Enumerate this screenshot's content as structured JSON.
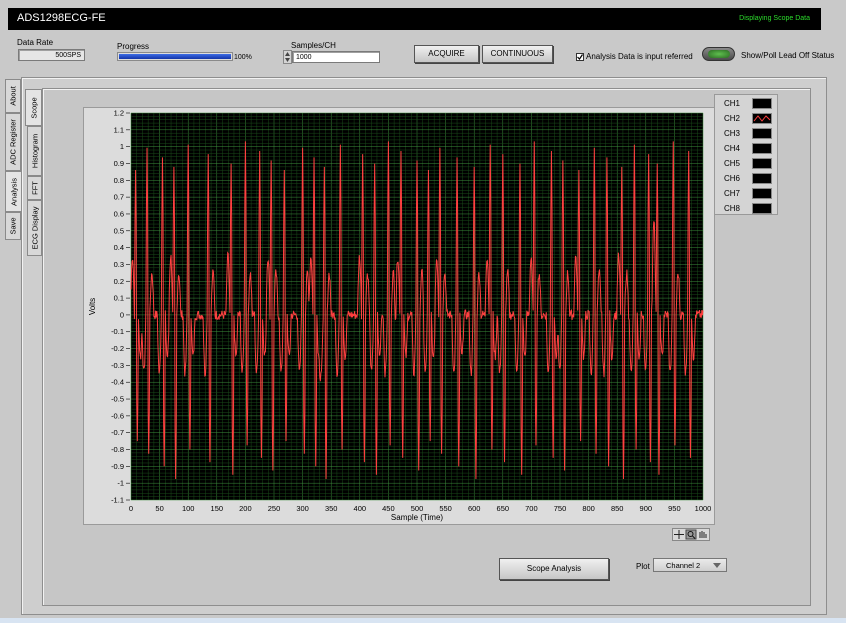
{
  "window": {
    "title": "ADS1298ECG-FE",
    "status": "Displaying Scope Data"
  },
  "controls": {
    "data_rate_label": "Data Rate",
    "data_rate_value": "500SPS",
    "progress_label": "Progress",
    "progress_value": "100%",
    "progress_fraction": 1.0,
    "samples_label": "Samples/CH",
    "samples_value": "1000",
    "acquire_label": "ACQUIRE",
    "continuous_label": "CONTINUOUS",
    "analysis_checkbox_label": "Analysis Data is input referred",
    "analysis_checked": true,
    "lead_off_label": "Show/Poll Lead Off Status"
  },
  "outer_tabs": [
    "About",
    "ADC Register",
    "Analysis",
    "Save"
  ],
  "inner_tabs": [
    "Scope",
    "Histogram",
    "FFT",
    "ECG Display"
  ],
  "legend": {
    "channels": [
      "CH1",
      "CH2",
      "CH3",
      "CH4",
      "CH5",
      "CH6",
      "CH7",
      "CH8"
    ],
    "active_channel": "CH2",
    "active_color": "#ff4040"
  },
  "bottom": {
    "scope_analysis_label": "Scope Analysis",
    "plot_label": "Plot",
    "plot_value": "Channel 2"
  },
  "chart_data": {
    "type": "line",
    "xlabel": "Sample (Time)",
    "ylabel": "Volts",
    "xlim": [
      0,
      1000
    ],
    "ylim": [
      -1.1,
      1.2
    ],
    "xticks": [
      "0",
      "50",
      "100",
      "150",
      "200",
      "250",
      "300",
      "350",
      "400",
      "450",
      "500",
      "550",
      "600",
      "650",
      "700",
      "750",
      "800",
      "850",
      "900",
      "950",
      "1000"
    ],
    "yticks": [
      "1.2",
      "1.1",
      "1",
      "0.9",
      "0.8",
      "0.7",
      "0.6",
      "0.5",
      "0.4",
      "0.3",
      "0.2",
      "0.1",
      "0",
      "-0.1",
      "-0.2",
      "-0.3",
      "-0.4",
      "-0.5",
      "-0.6",
      "-0.7",
      "-0.8",
      "-0.9",
      "-1",
      "-1.1"
    ],
    "grid": true,
    "background": "#000000",
    "grid_color": "#2f7a2f",
    "series": [
      {
        "name": "CH2",
        "color": "#ff4040",
        "approx_peak_sample_positions": [
          8,
          28,
          55,
          75,
          100,
          135,
          175,
          200,
          225,
          245,
          268,
          300,
          320,
          338,
          366,
          405,
          426,
          450,
          472,
          500,
          520,
          540,
          570,
          600,
          628,
          650,
          680,
          705,
          735,
          755,
          783,
          810,
          832,
          858,
          880,
          905,
          920,
          948,
          975
        ],
        "approx_peak_volts": 1.05,
        "approx_trough_volts": -1.0,
        "baseline_volts": 0.0
      }
    ]
  },
  "graph_tools": [
    "cursor-icon",
    "zoom-icon",
    "pan-icon"
  ]
}
